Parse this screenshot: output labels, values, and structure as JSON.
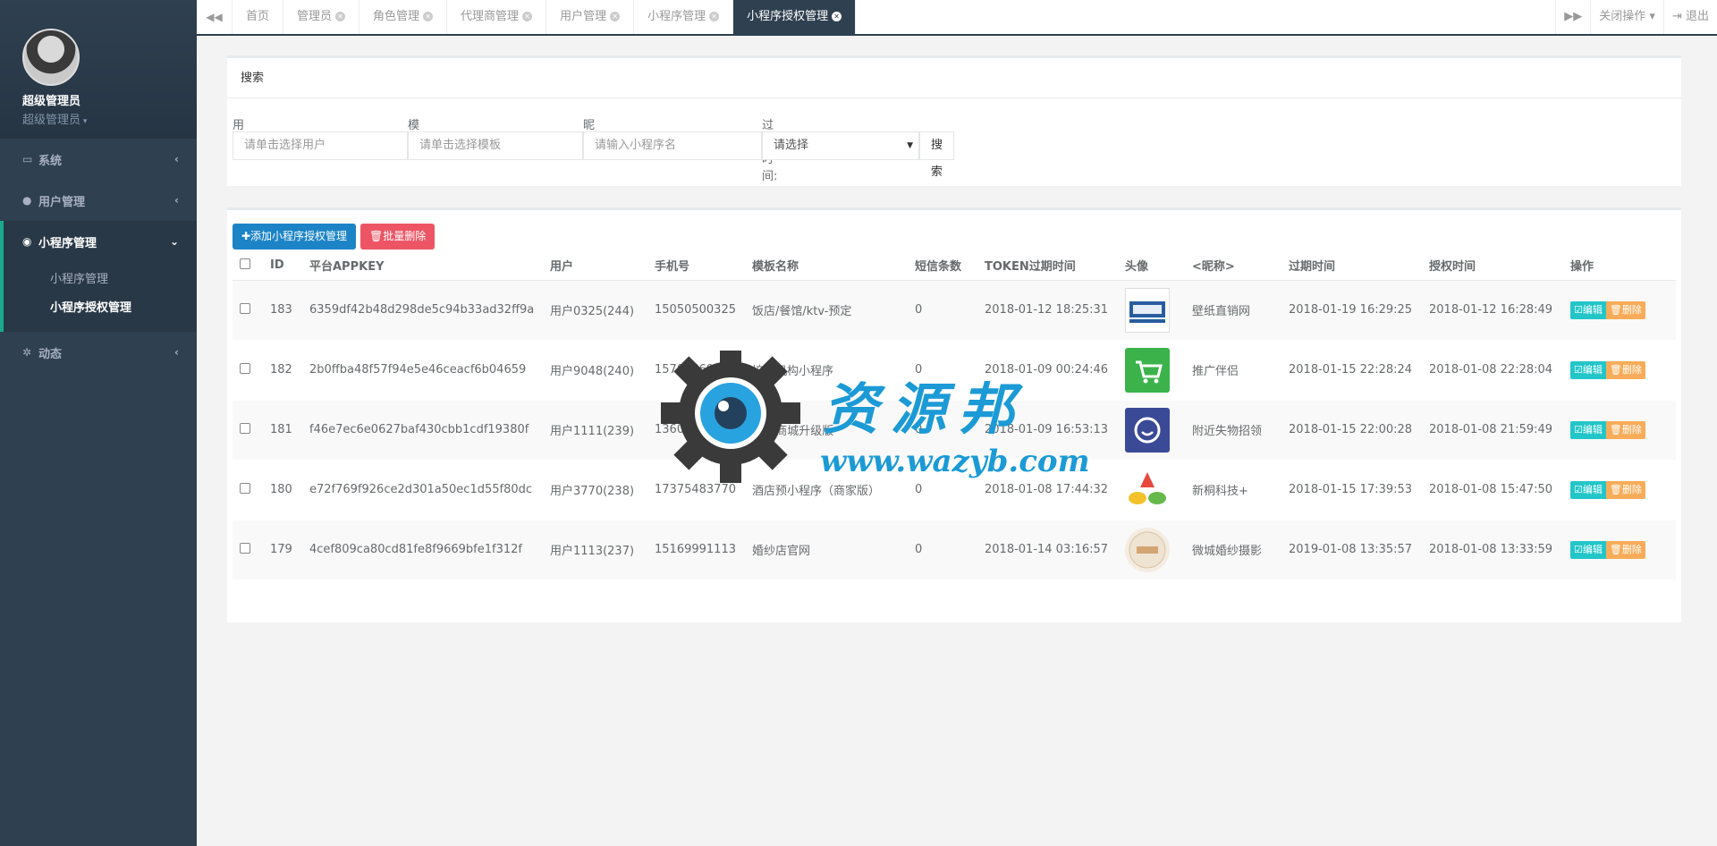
{
  "sidebar": {
    "user_name": "超级管理员",
    "user_role": "超级管理员",
    "menu": [
      {
        "label": "系统"
      },
      {
        "label": "用户管理"
      },
      {
        "label": "小程序管理"
      },
      {
        "label": "动态"
      }
    ],
    "submenu": [
      {
        "label": "小程序管理"
      },
      {
        "label": "小程序授权管理"
      }
    ]
  },
  "tabs": [
    {
      "label": "首页"
    },
    {
      "label": "管理员"
    },
    {
      "label": "角色管理"
    },
    {
      "label": "代理商管理"
    },
    {
      "label": "用户管理"
    },
    {
      "label": "小程序管理"
    },
    {
      "label": "小程序授权管理"
    }
  ],
  "toolbar": {
    "close_ops": "关闭操作",
    "logout": "退出"
  },
  "search": {
    "title": "搜索",
    "user_label": "用户:",
    "user_placeholder": "请单击选择用户",
    "template_label": "模板:",
    "template_placeholder": "请单击选择模板",
    "nickname_label": "昵称:",
    "nickname_placeholder": "请输入小程序名",
    "expire_label": "过期时间:",
    "expire_value": "请选择",
    "search_button": "搜索"
  },
  "actions": {
    "add": "✚添加小程序授权管理",
    "batch_delete": "🗑批量删除"
  },
  "table": {
    "headers": [
      "ID",
      "平台APPKEY",
      "用户",
      "手机号",
      "模板名称",
      "短信条数",
      "TOKEN过期时间",
      "头像",
      "<昵称>",
      "过期时间",
      "授权时间",
      "操作"
    ],
    "rows": [
      {
        "id": "183",
        "appkey": "6359df42b48d298de5c94b33ad32ff9a",
        "user": "用户0325(244)",
        "phone": "15050500325",
        "template": "饭店/餐馆/ktv-预定",
        "sms": "0",
        "token_exp": "2018-01-12 18:25:31",
        "nickname": "壁纸直销网",
        "expire": "2018-01-19 16:29:25",
        "auth": "2018-01-12 16:28:49"
      },
      {
        "id": "182",
        "appkey": "2b0ffba48f57f94e5e46ceacf6b04659",
        "user": "用户9048(240)",
        "phone": "15702569048",
        "template": "培训机构小程序",
        "sms": "0",
        "token_exp": "2018-01-09 00:24:46",
        "nickname": "推广伴侣",
        "expire": "2018-01-15 22:28:24",
        "auth": "2018-01-08 22:28:04"
      },
      {
        "id": "181",
        "appkey": "f46e7ec6e0627baf430cbb1cdf19380f",
        "user": "用户1111(239)",
        "phone": "13608661111",
        "template": "B2C商城升级版",
        "sms": "0",
        "token_exp": "2018-01-09 16:53:13",
        "nickname": "附近失物招领",
        "expire": "2018-01-15 22:00:28",
        "auth": "2018-01-08 21:59:49"
      },
      {
        "id": "180",
        "appkey": "e72f769f926ce2d301a50ec1d55f80dc",
        "user": "用户3770(238)",
        "phone": "17375483770",
        "template": "酒店预小程序（商家版）",
        "sms": "0",
        "token_exp": "2018-01-08 17:44:32",
        "nickname": "新桐科技+",
        "expire": "2018-01-15 17:39:53",
        "auth": "2018-01-08 15:47:50"
      },
      {
        "id": "179",
        "appkey": "4cef809ca80cd81fe8f9669bfe1f312f",
        "user": "用户1113(237)",
        "phone": "15169991113",
        "template": "婚纱店官网",
        "sms": "0",
        "token_exp": "2018-01-14 03:16:57",
        "nickname": "微城婚纱摄影",
        "expire": "2019-01-08 13:35:57",
        "auth": "2018-01-08 13:33:59"
      }
    ],
    "edit_label": "☑编辑",
    "delete_label": "🗑删除"
  },
  "watermark": {
    "text": "资源邦",
    "url": "www.wazyb.com"
  }
}
